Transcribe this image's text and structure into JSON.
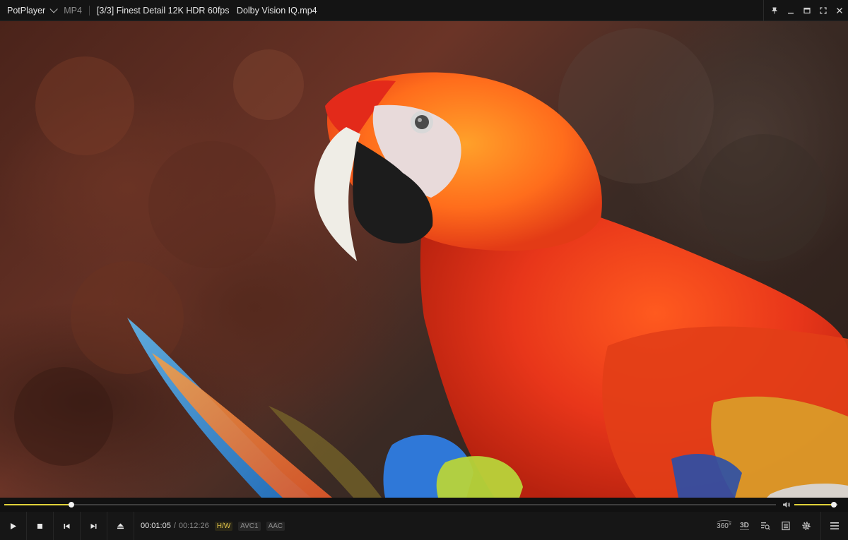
{
  "titlebar": {
    "app_name": "PotPlayer",
    "format": "MP4",
    "file_title": "[3/3] Finest Detail 12K HDR 60fps   Dolby Vision IQ.mp4",
    "buttons": [
      "pin-icon",
      "minimize-icon",
      "maximize-icon",
      "fullscreen-icon",
      "close-icon"
    ]
  },
  "playback": {
    "current_time": "00:01:05",
    "separator": "/",
    "total_time": "00:12:26",
    "progress_fraction": 0.0871,
    "volume_fraction": 0.9
  },
  "badges": {
    "hw": "H/W",
    "video_codec": "AVC1",
    "audio_codec": "AAC"
  },
  "controls": {
    "left_icons": [
      "play-icon",
      "stop-icon",
      "previous-icon",
      "next-icon",
      "eject-icon"
    ],
    "right_labels": {
      "vr": "360",
      "stereo": "3D"
    },
    "right_icons": [
      "360-icon",
      "3d-icon",
      "playlist-search-icon",
      "chapter-list-icon",
      "settings-icon",
      "menu-icon"
    ]
  },
  "colors": {
    "accent": "#e0d23a",
    "hw_badge": "#e0c34a",
    "background": "#141414"
  }
}
